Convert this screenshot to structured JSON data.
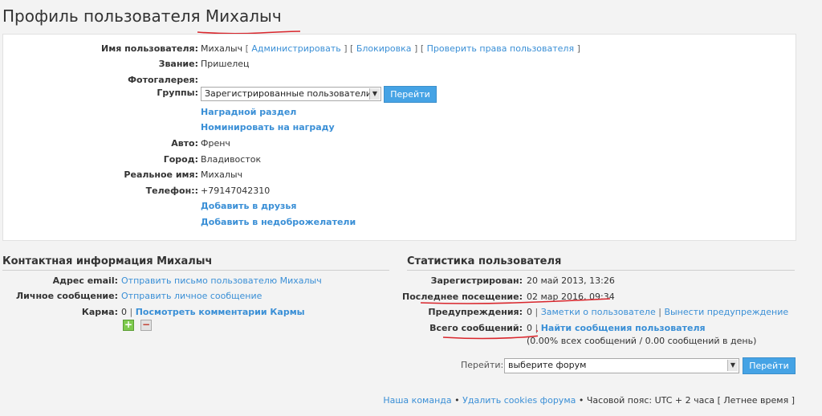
{
  "page_title": "Профиль пользователя Михалыч",
  "profile": {
    "username_label": "Имя пользователя:",
    "username_value": "Михалыч",
    "admin_link": "Администрировать",
    "block_link": "Блокировка",
    "check_rights_link": "Проверить права пользователя",
    "rank_label": "Звание:",
    "rank_value": "Пришелец",
    "gallery_label": "Фотогалерея:",
    "groups_label": "Группы:",
    "groups_selected": "Зарегистрированные пользователи",
    "groups_go_button": "Перейти",
    "awards_link": "Наградной раздел",
    "nominate_link": "Номинировать на награду",
    "car_label": "Авто:",
    "car_value": "Френч",
    "city_label": "Город:",
    "city_value": "Владивосток",
    "realname_label": "Реальное имя:",
    "realname_value": "Михалыч",
    "phone_label": "Телефон::",
    "phone_value": "+79147042310",
    "add_friend_link": "Добавить в друзья",
    "add_foe_link": "Добавить в недоброжелатели"
  },
  "contact": {
    "title": "Контактная информация Михалыч",
    "email_label": "Адрес email:",
    "email_link": "Отправить письмо пользователю Михалыч",
    "pm_label": "Личное сообщение:",
    "pm_link": "Отправить личное сообщение",
    "karma_label": "Карма:",
    "karma_value": "0",
    "karma_comments_link": "Посмотреть комментарии Кармы",
    "karma_plus": "+",
    "karma_minus": "−"
  },
  "stats": {
    "title": "Статистика пользователя",
    "registered_label": "Зарегистрирован:",
    "registered_value": "20 май 2013, 13:26",
    "last_visit_label": "Последнее посещение:",
    "last_visit_value": "02 мар 2016, 09:34",
    "warnings_label": "Предупреждения:",
    "warnings_value": "0",
    "user_notes_link": "Заметки о пользователе",
    "issue_warning_link": "Вынести предупреждение",
    "posts_label": "Всего сообщений:",
    "posts_value": "0",
    "find_posts_link": "Найти сообщения пользователя",
    "posts_percent": "(0.00% всех сообщений / 0.00 сообщений в день)"
  },
  "jump": {
    "label": "Перейти:",
    "selected": "выберите форум",
    "button": "Перейти"
  },
  "footer": {
    "team_link": "Наша команда",
    "delete_cookies_link": "Удалить cookies форума",
    "timezone_text": "Часовой пояс: UTC + 2 часа [ Летнее время ]"
  },
  "colors": {
    "link": "#3a8fd6",
    "button": "#45a3e5",
    "annotation": "#d9262c"
  }
}
